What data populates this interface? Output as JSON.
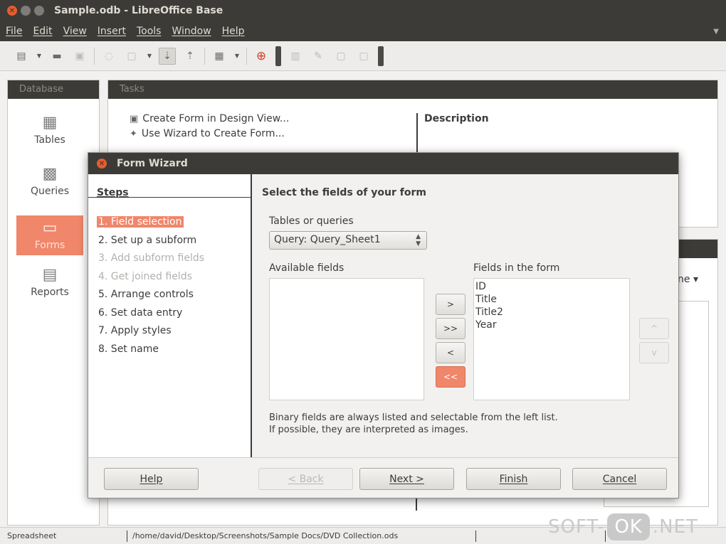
{
  "window": {
    "title": "Sample.odb - LibreOffice Base"
  },
  "menu": [
    "File",
    "Edit",
    "View",
    "Insert",
    "Tools",
    "Window",
    "Help"
  ],
  "toolbar": {
    "icons": [
      "new-document-icon",
      "open-folder-icon",
      "save-icon",
      "undo-icon",
      "paste-icon",
      "sort-ascending-icon",
      "sort-descending-icon",
      "form-icon",
      "help-icon",
      "printer-icon",
      "edit-icon",
      "delete-icon",
      "rename-icon"
    ]
  },
  "database_pane": {
    "header": "Database",
    "items": [
      {
        "label": "Tables",
        "icon": "tables-icon",
        "selected": false
      },
      {
        "label": "Queries",
        "icon": "queries-icon",
        "selected": false
      },
      {
        "label": "Forms",
        "icon": "forms-icon",
        "selected": true
      },
      {
        "label": "Reports",
        "icon": "reports-icon",
        "selected": false
      }
    ]
  },
  "tasks_pane": {
    "header": "Tasks",
    "tasks": [
      "Create Form in Design View...",
      "Use Wizard to Create Form..."
    ],
    "description_label": "Description"
  },
  "forms_pane": {
    "peek_text": "ne"
  },
  "dialog": {
    "title": "Form Wizard",
    "steps_heading": "Steps",
    "steps": [
      {
        "label": "1. Field selection",
        "state": "active"
      },
      {
        "label": "2. Set up a subform",
        "state": "enabled"
      },
      {
        "label": "3. Add subform fields",
        "state": "disabled"
      },
      {
        "label": "4. Get joined fields",
        "state": "disabled"
      },
      {
        "label": "5. Arrange controls",
        "state": "enabled"
      },
      {
        "label": "6. Set data entry",
        "state": "enabled"
      },
      {
        "label": "7. Apply styles",
        "state": "enabled"
      },
      {
        "label": "8. Set name",
        "state": "enabled"
      }
    ],
    "heading": "Select the fields of your form",
    "tables_label": "Tables or queries",
    "tables_value": "Query: Query_Sheet1",
    "available_label": "Available fields",
    "available_fields": [],
    "form_fields_label": "Fields in the form",
    "form_fields": [
      "ID",
      "Title",
      "Title2",
      "Year"
    ],
    "move_buttons": {
      "add": ">",
      "add_all": ">>",
      "remove": "<",
      "remove_all": "<<"
    },
    "order_buttons": {
      "up": "^",
      "down": "v"
    },
    "note_line1": "Binary fields are always listed and selectable from the left list.",
    "note_line2": "If possible, they are interpreted as images.",
    "footer": {
      "help": "Help",
      "back": "< Back",
      "next": "Next >",
      "finish": "Finish",
      "cancel": "Cancel"
    }
  },
  "status_bar": {
    "left": "Spreadsheet",
    "path": "/home/david/Desktop/Screenshots/Sample Docs/DVD Collection.ods"
  },
  "watermark": {
    "part1": "SOFT-",
    "part2": "OK",
    "part3": ".NET"
  },
  "colors": {
    "accent": "#f0866a",
    "titlebar": "#3c3b37",
    "close_button": "#e45d30"
  }
}
